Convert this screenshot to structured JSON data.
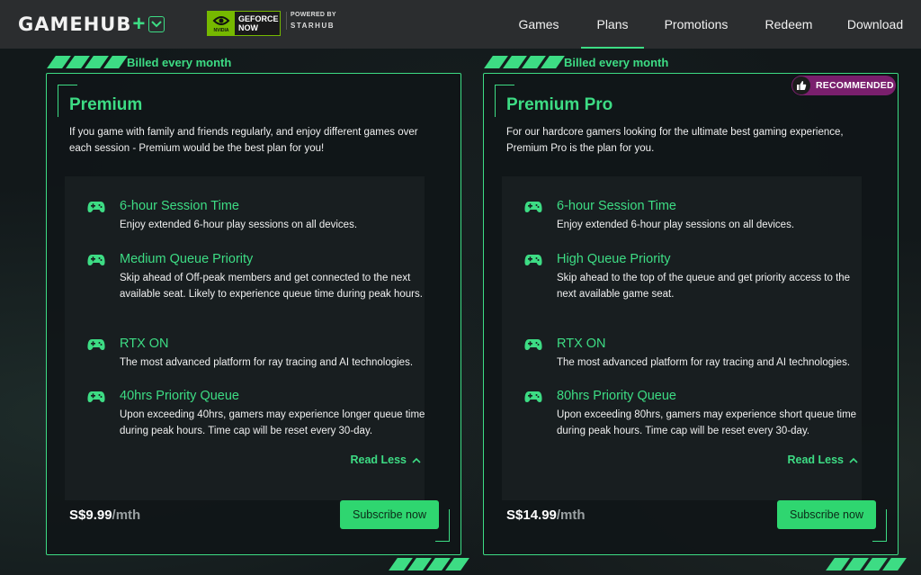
{
  "header": {
    "logo": "GAMEHUB",
    "logo_plus": "+",
    "nvidia_label": "NVIDIA",
    "geforce_now": "GEFORCE NOW",
    "powered_by": "POWERED BY",
    "starhub": "STARHUB",
    "nav": [
      {
        "label": "Games",
        "active": false
      },
      {
        "label": "Plans",
        "active": true
      },
      {
        "label": "Promotions",
        "active": false
      },
      {
        "label": "Redeem",
        "active": false
      },
      {
        "label": "Download",
        "active": false
      }
    ]
  },
  "colors": {
    "accent": "#3ddc84",
    "recommended_badge": "#7a1f6d",
    "header_bg": "#2b2d2f"
  },
  "plans": [
    {
      "billing": "Billed every month",
      "title": "Premium",
      "description": "If you game with family and friends regularly, and enjoy different games over each session - Premium would be the best plan for you!",
      "features": [
        {
          "icon": "gamepad-icon",
          "title": "6-hour Session Time",
          "desc": "Enjoy extended 6-hour play sessions on all devices."
        },
        {
          "icon": "gamepad-icon",
          "title": "Medium Queue Priority",
          "desc": "Skip ahead of Off-peak members and get connected to the next available seat. Likely to experience queue time during peak hours."
        },
        {
          "icon": "gamepad-icon",
          "title": "RTX ON",
          "desc": "The most advanced platform for ray tracing and AI technologies."
        },
        {
          "icon": "gamepad-icon",
          "title": "40hrs Priority Queue",
          "desc": "Upon exceeding 40hrs, gamers may experience longer queue time during peak hours. Time cap will be reset every 30-day."
        }
      ],
      "read_less": "Read Less",
      "price": "S$9.99",
      "price_unit": "/mth",
      "subscribe": "Subscribe now"
    },
    {
      "billing": "Billed every month",
      "badge": "RECOMMENDED",
      "title": "Premium Pro",
      "description": "For our hardcore gamers looking for the ultimate best gaming experience, Premium Pro is the plan for you.",
      "features": [
        {
          "icon": "gamepad-icon",
          "title": "6-hour Session Time",
          "desc": "Enjoy extended 6-hour play sessions on all devices."
        },
        {
          "icon": "gamepad-icon",
          "title": "High Queue Priority",
          "desc": "Skip ahead to the top of the queue and get priority access to the next available game seat."
        },
        {
          "icon": "gamepad-icon",
          "title": "RTX ON",
          "desc": "The most advanced platform for ray tracing and AI technologies."
        },
        {
          "icon": "gamepad-icon",
          "title": "80hrs Priority Queue",
          "desc": "Upon exceeding 80hrs, gamers may experience short queue time during peak hours. Time cap will be reset every 30-day."
        }
      ],
      "read_less": "Read Less",
      "price": "S$14.99",
      "price_unit": "/mth",
      "subscribe": "Subscribe now"
    }
  ]
}
